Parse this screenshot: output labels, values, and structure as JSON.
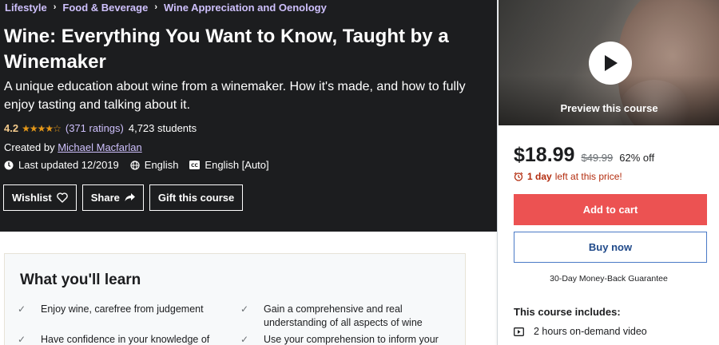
{
  "breadcrumb": {
    "items": [
      "Lifestyle",
      "Food & Beverage",
      "Wine Appreciation and Oenology"
    ],
    "separator": "›"
  },
  "course": {
    "title": "Wine: Everything You Want to Know, Taught by a Winemaker",
    "subtitle": "A unique education about wine from a winemaker. How it's made, and how to fully enjoy tasting and talking about it.",
    "rating": "4.2",
    "rating_value": 4.2,
    "rating_max": 5,
    "stars_glyphs": "★★★★☆",
    "ratings_count": "(371 ratings)",
    "students": "4,723 students",
    "created_by_label": "Created by",
    "instructor": "Michael Macfarlan",
    "last_updated": "Last updated 12/2019",
    "language": "English",
    "captions": "English [Auto]"
  },
  "actions": {
    "wishlist": "Wishlist",
    "share": "Share",
    "gift": "Gift this course"
  },
  "learn": {
    "heading": "What you'll learn",
    "items": [
      "Enjoy wine, carefree from judgement",
      "Gain a comprehensive and real understanding of all aspects of wine",
      "Have confidence in your knowledge of wine",
      "Use your comprehension to inform your"
    ]
  },
  "sidebar": {
    "preview_label": "Preview this course",
    "price": "$18.99",
    "original_price": "$49.99",
    "discount": "62% off",
    "urgency_bold": "1 day",
    "urgency_rest": "left at this price!",
    "add_to_cart": "Add to cart",
    "buy_now": "Buy now",
    "guarantee": "30-Day Money-Back Guarantee",
    "includes_title": "This course includes:",
    "includes": [
      "2 hours on-demand video"
    ]
  },
  "colors": {
    "hero_bg": "#1c1d1f",
    "link_purple": "#cec0fc",
    "star": "#e59819",
    "rating_num": "#f3ca8c",
    "cart_red": "#ec5252",
    "urgency_red": "#b32d0f"
  },
  "icons": [
    "heart-icon",
    "share-arrow-icon",
    "clock-icon",
    "globe-icon",
    "cc-icon",
    "play-icon",
    "alarm-icon",
    "video-icon",
    "check-icon"
  ]
}
